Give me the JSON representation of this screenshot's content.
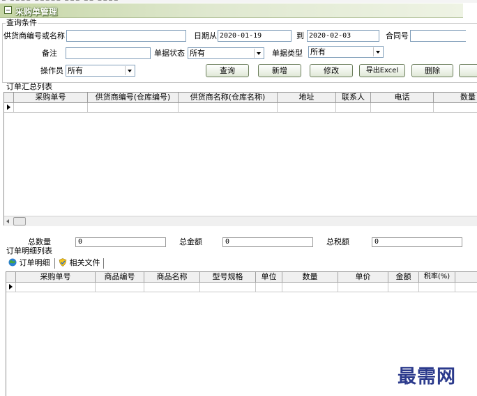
{
  "window": {
    "title": "采购单管理"
  },
  "query": {
    "group_label": "查询条件",
    "supplier_label": "供货商编号或名称",
    "supplier_value": "",
    "date_from_label": "日期从",
    "date_from": "2020-01-19",
    "date_to_label": "到",
    "date_to": "2020-02-03",
    "contract_label": "合同号",
    "contract_value": "",
    "remark_label": "备注",
    "remark_value": "",
    "status_label": "单据状态",
    "status_value": "所有",
    "type_label": "单据类型",
    "type_value": "所有",
    "operator_label": "操作员",
    "operator_value": "所有"
  },
  "toolbar": {
    "query": "查询",
    "new": "新增",
    "edit": "修改",
    "export": "导出Excel",
    "delete": "删除"
  },
  "summary": {
    "group_label": "订单汇总列表",
    "columns": [
      "采购单号",
      "供货商编号(仓库编号)",
      "供货商名称(仓库名称)",
      "地址",
      "联系人",
      "电话",
      "数量"
    ]
  },
  "totals": {
    "qty_label": "总数量",
    "qty_value": "0",
    "amount_label": "总金额",
    "amount_value": "0",
    "tax_label": "总税额",
    "tax_value": "0"
  },
  "detail": {
    "group_label": "订单明细列表",
    "tabs": [
      {
        "label": "订单明细",
        "icon": "globe-icon"
      },
      {
        "label": "相关文件",
        "icon": "shield-icon"
      }
    ],
    "columns": [
      "采购单号",
      "商品编号",
      "商品名称",
      "型号规格",
      "单位",
      "数量",
      "单价",
      "金额",
      "税率(%)"
    ]
  },
  "watermark": "最需网",
  "colors": {
    "title_start": "#c6d6a6",
    "title_end": "#eef3e4",
    "watermark": "#2b3a8c",
    "input_border": "#7f9db9"
  }
}
